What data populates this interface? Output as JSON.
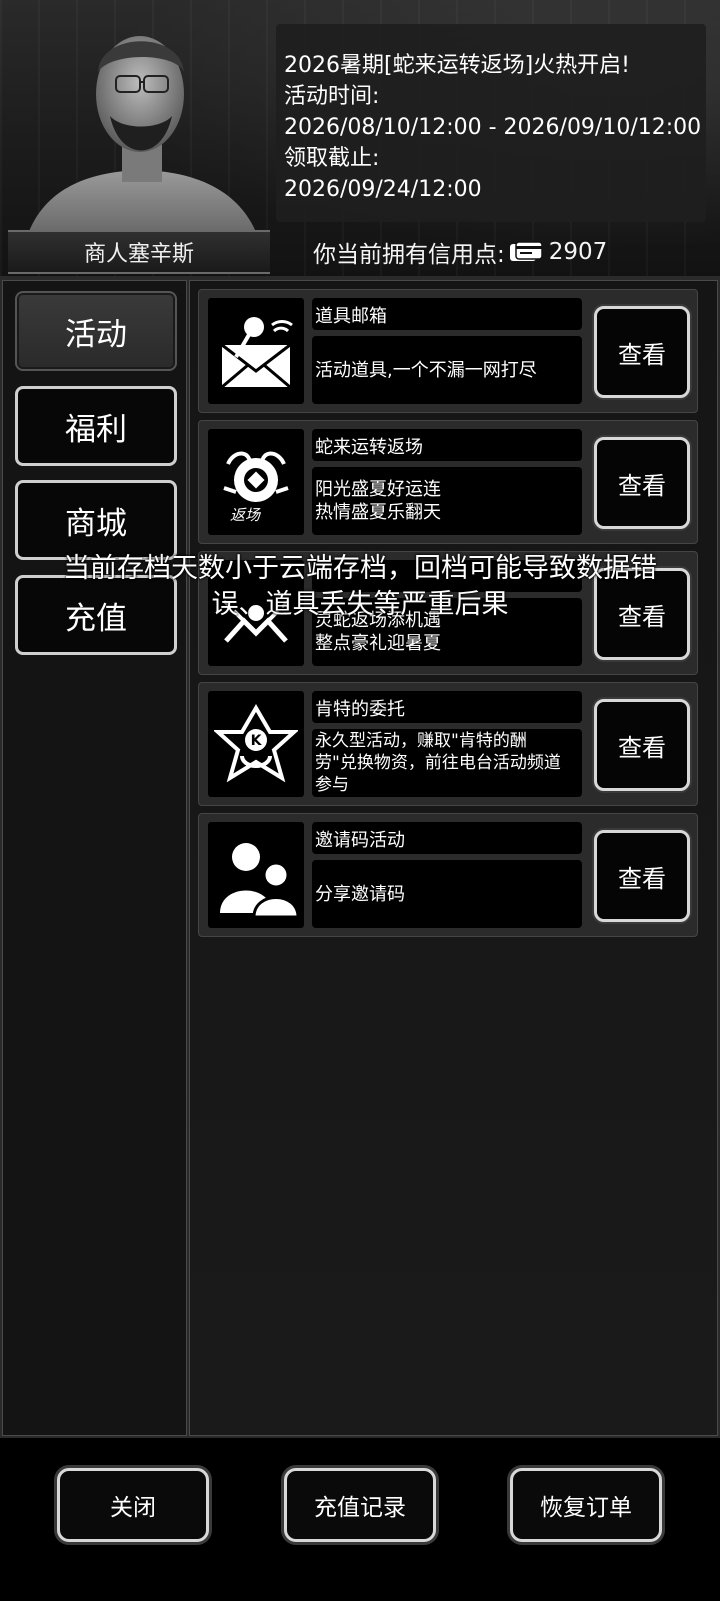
{
  "header": {
    "merchant_name": "商人塞辛斯",
    "info_lines": [
      "2026暑期[蛇来运转返场]火热开启!",
      "活动时间:",
      "2026/08/10/12:00 - 2026/09/10/12:00",
      "领取截止:",
      "2026/09/24/12:00"
    ],
    "credits_label": "你当前拥有信用点:",
    "credits_value": "2907"
  },
  "sidebar": {
    "tabs": [
      {
        "label": "活动",
        "active": true
      },
      {
        "label": "福利",
        "active": false
      },
      {
        "label": "商城",
        "active": false
      },
      {
        "label": "充值",
        "active": false
      }
    ]
  },
  "activities": [
    {
      "title": "道具邮箱",
      "desc": [
        "活动道具,一个不漏一网打尽"
      ],
      "button": "查看",
      "icon": "mail-icon"
    },
    {
      "title": "蛇来运转返场",
      "desc": [
        "阳光盛夏好运连",
        "热情盛夏乐翻天"
      ],
      "button": "查看",
      "icon": "snake-return-icon"
    },
    {
      "title": "",
      "desc": [
        "灵蛇返场添机遇",
        "整点豪礼迎暑夏"
      ],
      "button": "查看",
      "icon": "snake-gift-icon"
    },
    {
      "title": "肯特的委托",
      "desc": [
        "永久型活动，赚取\"肯特的酬",
        "劳\"兑换物资，前往电台活动频道",
        "参与"
      ],
      "button": "查看",
      "icon": "kent-emblem-icon"
    },
    {
      "title": "邀请码活动",
      "desc": [
        "分享邀请码"
      ],
      "button": "查看",
      "icon": "people-icon"
    }
  ],
  "toast": {
    "line1": "当前存档天数小于云端存档，回档可能导致数据错",
    "line2": "误、道具丢失等严重后果"
  },
  "footer": {
    "close": "关闭",
    "recharge_history": "充值记录",
    "restore_order": "恢复订单"
  }
}
